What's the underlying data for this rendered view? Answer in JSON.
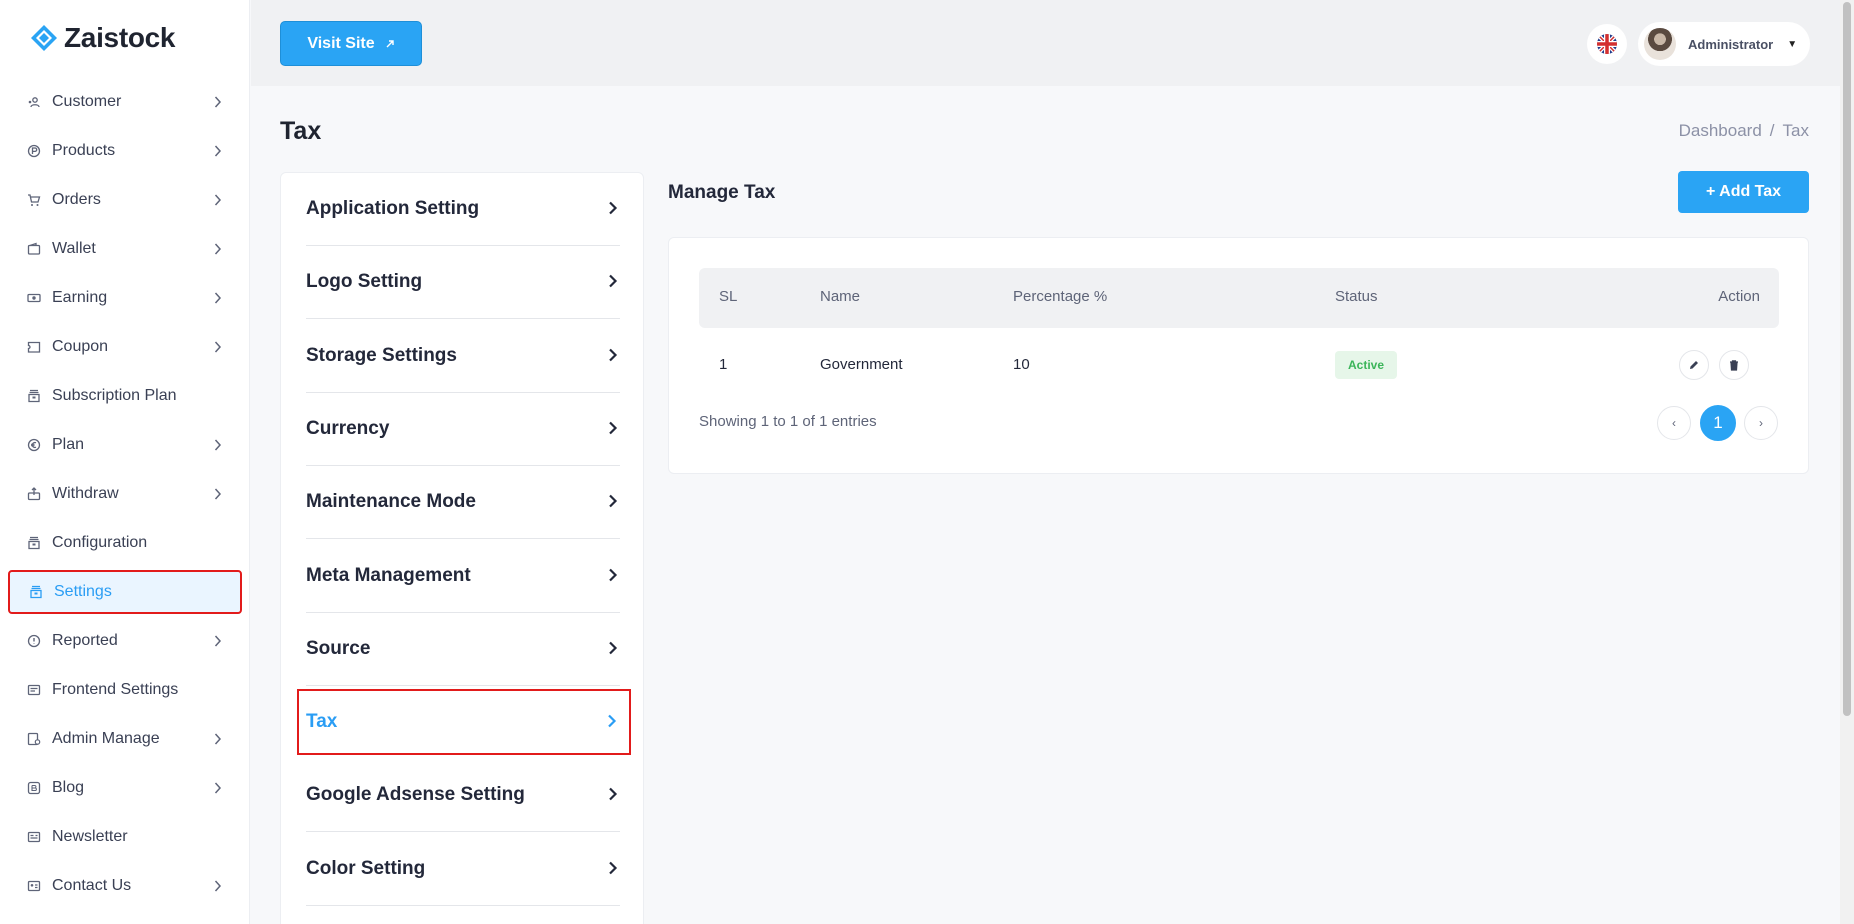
{
  "app": {
    "name": "Zaistock"
  },
  "sidebar": {
    "items": [
      {
        "label": "Customer",
        "icon": "users-icon",
        "has_chevron": true
      },
      {
        "label": "Products",
        "icon": "products-icon",
        "has_chevron": true
      },
      {
        "label": "Orders",
        "icon": "cart-icon",
        "has_chevron": true
      },
      {
        "label": "Wallet",
        "icon": "wallet-icon",
        "has_chevron": true
      },
      {
        "label": "Earning",
        "icon": "money-icon",
        "has_chevron": true
      },
      {
        "label": "Coupon",
        "icon": "coupon-icon",
        "has_chevron": true
      },
      {
        "label": "Subscription Plan",
        "icon": "box-icon",
        "has_chevron": false
      },
      {
        "label": "Plan",
        "icon": "euro-circle-icon",
        "has_chevron": true
      },
      {
        "label": "Withdraw",
        "icon": "withdraw-icon",
        "has_chevron": true
      },
      {
        "label": "Configuration",
        "icon": "box-icon",
        "has_chevron": false
      },
      {
        "label": "Settings",
        "icon": "box-icon",
        "has_chevron": false,
        "active": true
      },
      {
        "label": "Reported",
        "icon": "info-circle-icon",
        "has_chevron": true
      },
      {
        "label": "Frontend Settings",
        "icon": "frontend-icon",
        "has_chevron": false
      },
      {
        "label": "Admin Manage",
        "icon": "admin-icon",
        "has_chevron": true
      },
      {
        "label": "Blog",
        "icon": "blog-icon",
        "has_chevron": true
      },
      {
        "label": "Newsletter",
        "icon": "newsletter-icon",
        "has_chevron": false
      },
      {
        "label": "Contact Us",
        "icon": "contact-card-icon",
        "has_chevron": true
      }
    ]
  },
  "topbar": {
    "visit_site_label": "Visit Site",
    "user_name": "Administrator"
  },
  "page": {
    "title": "Tax",
    "breadcrumb": {
      "home": "Dashboard",
      "separator": "/",
      "current": "Tax"
    }
  },
  "settings_menu": {
    "items": [
      {
        "label": "Application Setting"
      },
      {
        "label": "Logo Setting"
      },
      {
        "label": "Storage Settings"
      },
      {
        "label": "Currency"
      },
      {
        "label": "Maintenance Mode"
      },
      {
        "label": "Meta Management"
      },
      {
        "label": "Source"
      },
      {
        "label": "Tax",
        "active": true
      },
      {
        "label": "Google Adsense Setting"
      },
      {
        "label": "Color Setting"
      }
    ]
  },
  "manage": {
    "title": "Manage Tax",
    "add_label": "+ Add Tax",
    "columns": {
      "sl": "SL",
      "name": "Name",
      "percentage": "Percentage %",
      "status": "Status",
      "action": "Action"
    },
    "rows": [
      {
        "sl": "1",
        "name": "Government",
        "percentage": "10",
        "status": "Active"
      }
    ],
    "showing": "Showing 1 to 1 of 1 entries",
    "pagination": {
      "prev": "‹",
      "current": "1",
      "next": "›"
    }
  },
  "colors": {
    "accent": "#2aa4f4",
    "highlight_border": "#e21b1b",
    "active_badge_text": "#3cb55a",
    "active_badge_bg": "#e6f6e9"
  }
}
